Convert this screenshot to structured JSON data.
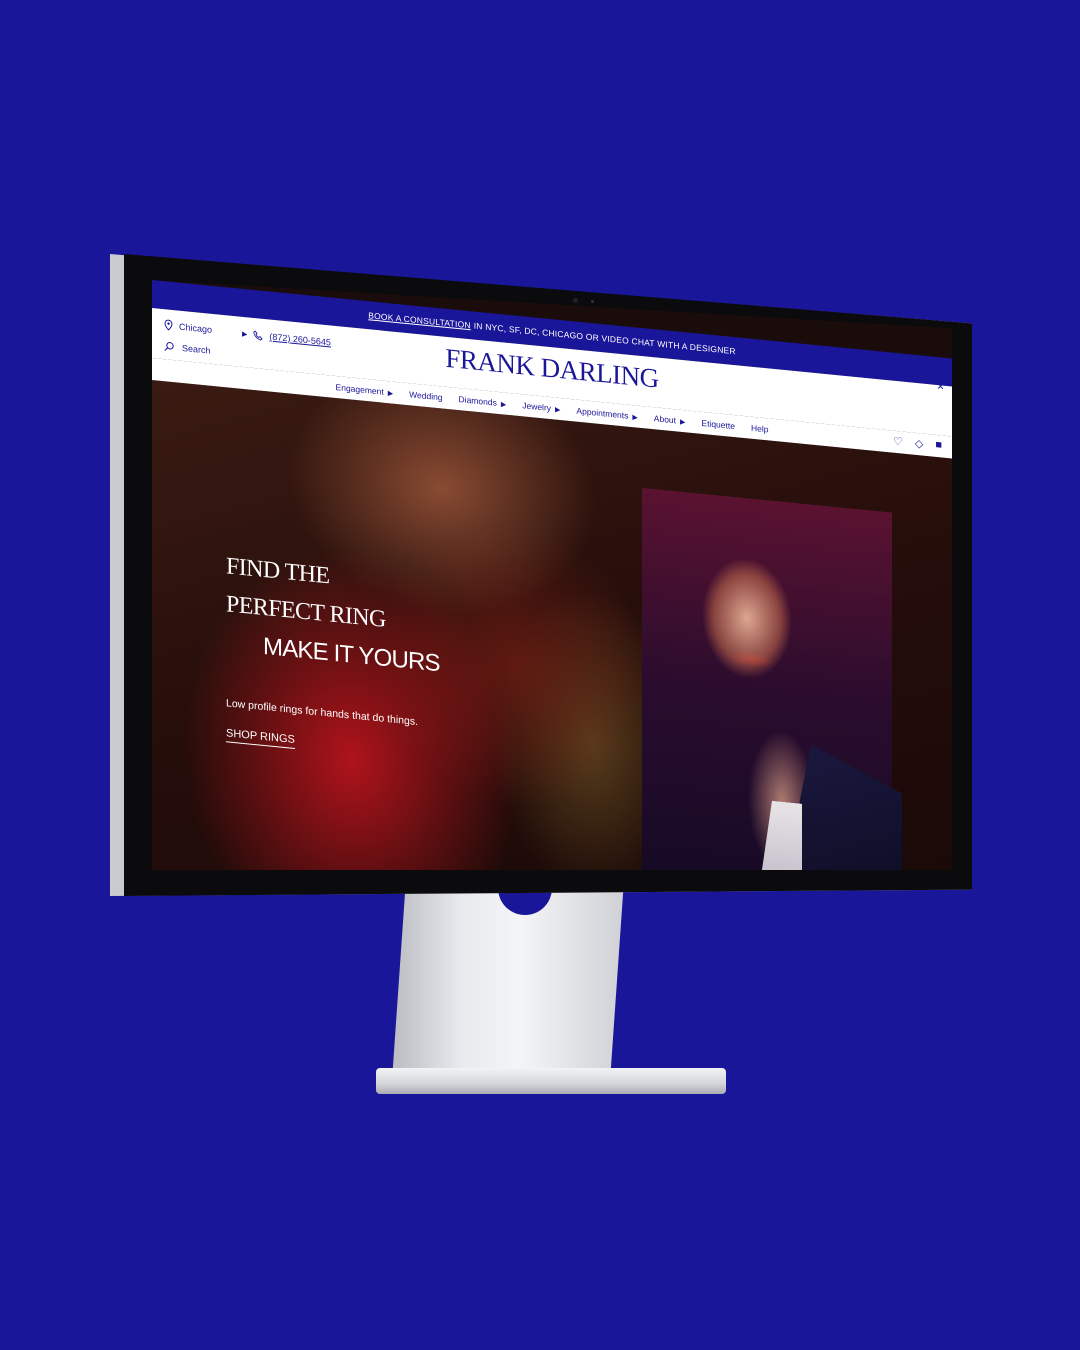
{
  "promo": {
    "link_text": "BOOK A CONSULTATION",
    "rest_text": "IN NYC, SF, DC, CHICAGO OR VIDEO CHAT WITH A DESIGNER",
    "close_icon": "×"
  },
  "header": {
    "location": "Chicago",
    "phone": "(872) 260-5645",
    "search_label": "Search",
    "brand": "FRANK DARLING"
  },
  "nav": {
    "items": [
      {
        "label": "Engagement",
        "has_menu": true
      },
      {
        "label": "Wedding",
        "has_menu": false
      },
      {
        "label": "Diamonds",
        "has_menu": true
      },
      {
        "label": "Jewelry",
        "has_menu": true
      },
      {
        "label": "Appointments",
        "has_menu": true
      },
      {
        "label": "About",
        "has_menu": true
      },
      {
        "label": "Etiquette",
        "has_menu": false
      },
      {
        "label": "Help",
        "has_menu": false
      }
    ],
    "icons": [
      "heart-icon",
      "diamond-icon",
      "bag-icon"
    ]
  },
  "hero": {
    "line1": "FIND THE",
    "line2": "PERFECT RING",
    "line3": "MAKE IT YOURS",
    "subtitle": "Low profile rings for hands that do things.",
    "cta": "SHOP RINGS"
  },
  "colors": {
    "brand_blue": "#1a1699",
    "background": "#1a1699"
  }
}
